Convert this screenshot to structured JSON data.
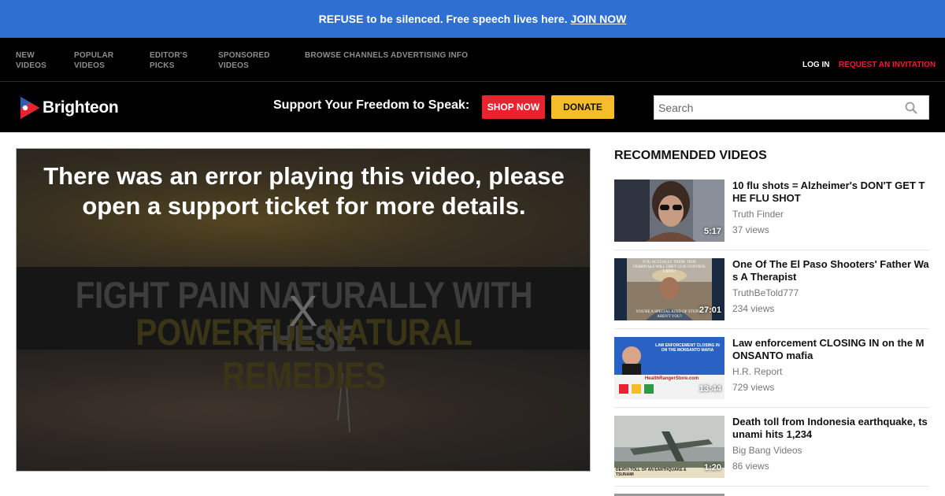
{
  "promo": {
    "message": "REFUSE to be silenced. Free speech lives here.",
    "join_label": "JOIN NOW"
  },
  "topnav": {
    "items": [
      {
        "label": "NEW\nVIDEOS"
      },
      {
        "label": "POPULAR\nVIDEOS"
      },
      {
        "label": "EDITOR'S\nPICKS"
      },
      {
        "label": "SPONSORED\nVIDEOS"
      },
      {
        "label": "BROWSE CHANNELS"
      },
      {
        "label": "ADVERTISING INFO"
      }
    ],
    "login_label": "LOG IN",
    "invite_label": "REQUEST AN INVITATION"
  },
  "header": {
    "brand": "Brighteon",
    "support_text": "Support Your Freedom to Speak:",
    "shop_label": "SHOP NOW",
    "donate_label": "DONATE",
    "search_placeholder": "Search"
  },
  "player": {
    "error_message": "There was an error playing this video, please open a support ticket for more details.",
    "poster_line1": "FIGHT PAIN NATURALLY WITH THESE",
    "poster_line2": "POWERFUL NATURAL REMEDIES",
    "close_icon": "X"
  },
  "sidebar": {
    "title": "RECOMMENDED VIDEOS",
    "videos": [
      {
        "title": "10 flu shots = Alzheimer's DON'T GET THE FLU SHOT",
        "channel": "Truth Finder",
        "views": "37 views",
        "duration": "5:17"
      },
      {
        "title": "One Of The El Paso Shooters' Father Was A Therapist",
        "channel": "TruthBeTold777",
        "views": "234 views",
        "duration": "27:01",
        "thumb_caption_top": "YOU ACTUALLY THINK THAT CRIMINALS WILL OBEY GUN CONTROL LAWS?",
        "thumb_caption_bottom": "YOU'RE A SPECIAL KIND OF STUPID, AREN'T YOU?"
      },
      {
        "title": "Law enforcement CLOSING IN on the MONSANTO mafia",
        "channel": "H.R. Report",
        "views": "729 views",
        "duration": "13:44",
        "thumb_caption_top": "LAW ENFORCEMENT CLOSING IN ON THE MONSANTO MAFIA",
        "thumb_caption_bottom": "HealthRangerStore.com"
      },
      {
        "title": "Death toll from Indonesia earthquake, tsunami hits 1,234",
        "channel": "Big Bang Videos",
        "views": "86 views",
        "duration": "1:20",
        "thumb_caption_bottom": "DEATH TOLL OF AN EARTHQUAKE & TSUNAMI"
      }
    ]
  },
  "colors": {
    "promo_bg": "#2f6fd2",
    "shop_bg": "#e8222f",
    "donate_bg": "#f6bd2a",
    "invite": "#e8222f"
  }
}
